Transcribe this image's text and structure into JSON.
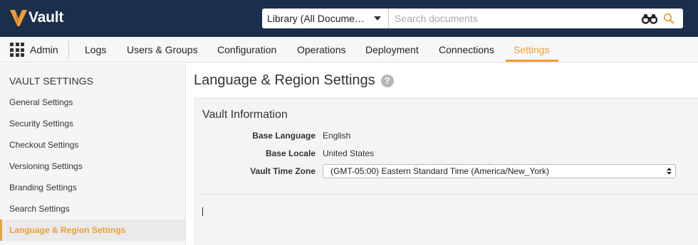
{
  "header": {
    "app_name": "Vault",
    "library_select": "Library (All Docume…",
    "search_placeholder": "Search documents",
    "brand_color": "#f19d37",
    "header_bg": "#1b2f4c",
    "icons": [
      "vault-logo-icon",
      "binoculars-icon",
      "search-icon"
    ]
  },
  "nav": {
    "admin_label": "Admin",
    "items": [
      "Logs",
      "Users & Groups",
      "Configuration",
      "Operations",
      "Deployment",
      "Connections",
      "Settings"
    ],
    "active": "Settings"
  },
  "sidebar": {
    "title": "VAULT SETTINGS",
    "items": [
      "General Settings",
      "Security Settings",
      "Checkout Settings",
      "Versioning Settings",
      "Branding Settings",
      "Search Settings",
      "Language & Region Settings"
    ],
    "active": "Language & Region Settings"
  },
  "main": {
    "title": "Language & Region Settings",
    "help_glyph": "?",
    "section_title": "Vault Information",
    "fields": [
      {
        "label": "Base Language",
        "value": "English"
      },
      {
        "label": "Base Locale",
        "value": "United States"
      },
      {
        "label": "Vault Time Zone",
        "value": "(GMT-05:00) Eastern Standard Time (America/New_York)"
      }
    ]
  }
}
